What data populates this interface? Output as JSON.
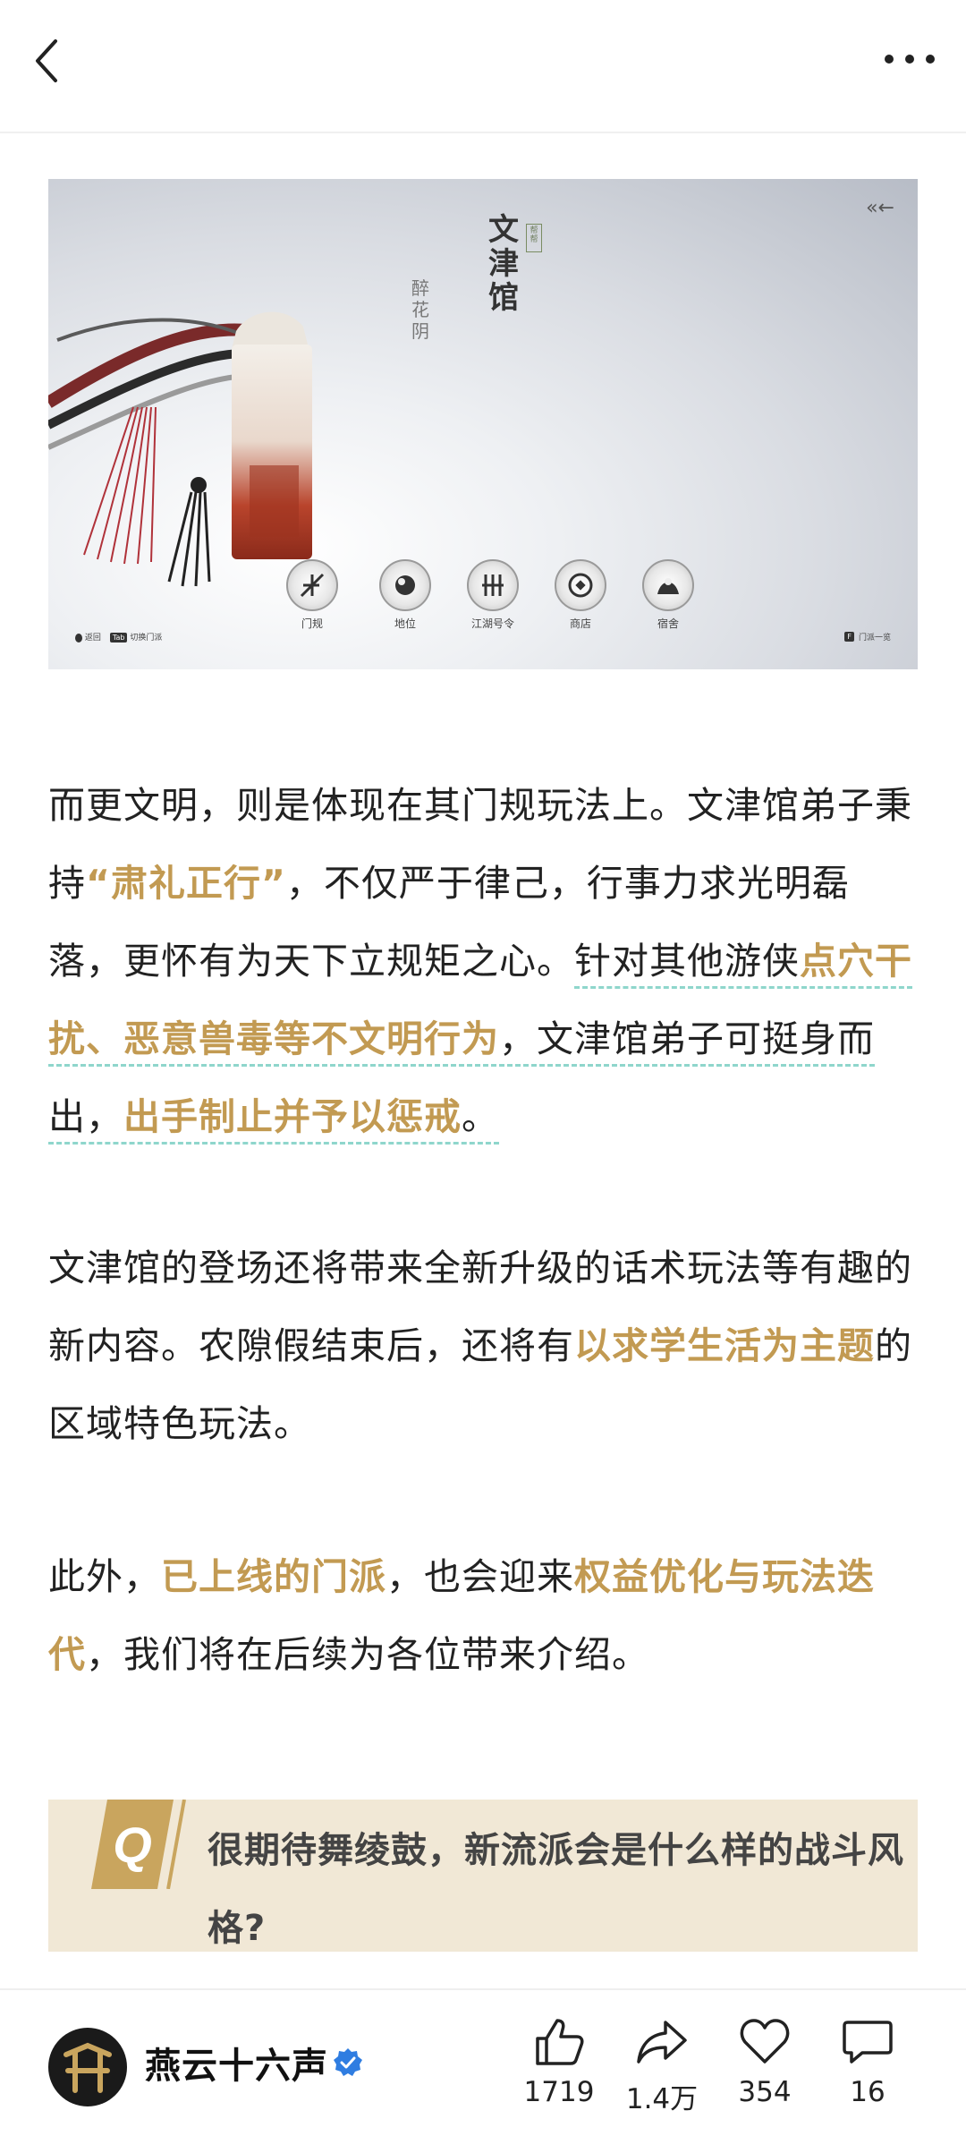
{
  "banner": {
    "title": "文津馆",
    "tag": "帮帮",
    "calligraphy": "醉花阴",
    "nav": [
      {
        "label": "门规"
      },
      {
        "label": "地位"
      },
      {
        "label": "江湖号令"
      },
      {
        "label": "商店"
      },
      {
        "label": "宿舍"
      }
    ],
    "bottom_left_back": "返回",
    "bottom_left_switch": "切换门派",
    "bottom_left_key": "Tab",
    "bottom_right": "门派一览",
    "bottom_right_key": "F"
  },
  "article": {
    "p1": {
      "t1": "而更文明，则是体现在其门规玩法上。文津馆弟子秉持",
      "h1": "“肃礼正行”",
      "t2": "，不仅严于律己，行事力求光明磊落，更怀有为天下立规矩之心。",
      "u1": "针对其他游侠",
      "h2": "点穴干扰、恶意兽毒等不文明行为",
      "t3": "，文津馆弟子可挺身而出，",
      "h3": "出手制止并予以惩戒",
      "t4": "。"
    },
    "p2": {
      "t1": "文津馆的登场还将带来全新升级的话术玩法等有趣的新内容。农隙假结束后，还将有",
      "h1": "以求学生活为主题",
      "t2": "的区域特色玩法。"
    },
    "p3": {
      "t1": "此外，",
      "h1": "已上线的门派",
      "t2": "，也会迎来",
      "h2": "权益优化与玩法迭代",
      "t3": "，我们将在后续为各位带来介绍。"
    },
    "q": {
      "badge": "Q",
      "text": "很期待舞绫鼓，新流派会是什么样的战斗风格?"
    }
  },
  "footer": {
    "author": "燕云十六声",
    "like_count": "1719",
    "share_count": "1.4万",
    "favorite_count": "354",
    "comment_count": "16"
  },
  "colors": {
    "highlight": "#c29a52",
    "q_background": "#f1e8d6",
    "verified": "#2f7de1"
  }
}
